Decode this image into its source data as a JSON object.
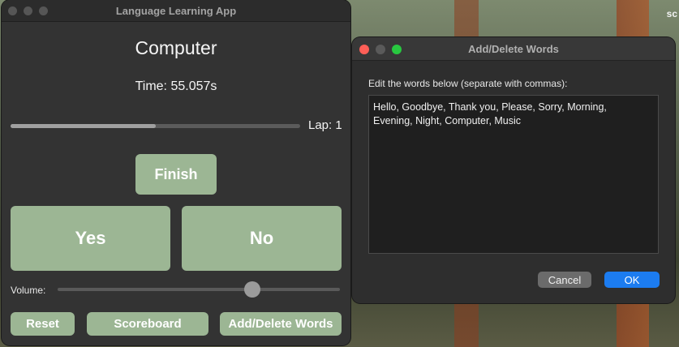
{
  "colors": {
    "button_green": "#9cb694",
    "window_bg": "#333333",
    "ok_blue": "#1c7cf0"
  },
  "desktop": {
    "edge_text": "sc"
  },
  "main_window": {
    "title": "Language Learning App",
    "current_word": "Computer",
    "time_text": "Time: 55.057s",
    "progress_fraction": 0.5,
    "lap_text": "Lap: 1",
    "finish_label": "Finish",
    "yes_label": "Yes",
    "no_label": "No",
    "volume_label": "Volume:",
    "volume_fraction": 0.69,
    "reset_label": "Reset",
    "scoreboard_label": "Scoreboard",
    "add_delete_label": "Add/Delete Words"
  },
  "dialog": {
    "title": "Add/Delete Words",
    "instruction": "Edit the words below (separate with commas):",
    "words_text": "Hello, Goodbye, Thank you, Please, Sorry, Morning,\nEvening, Night, Computer, Music",
    "cancel_label": "Cancel",
    "ok_label": "OK"
  }
}
